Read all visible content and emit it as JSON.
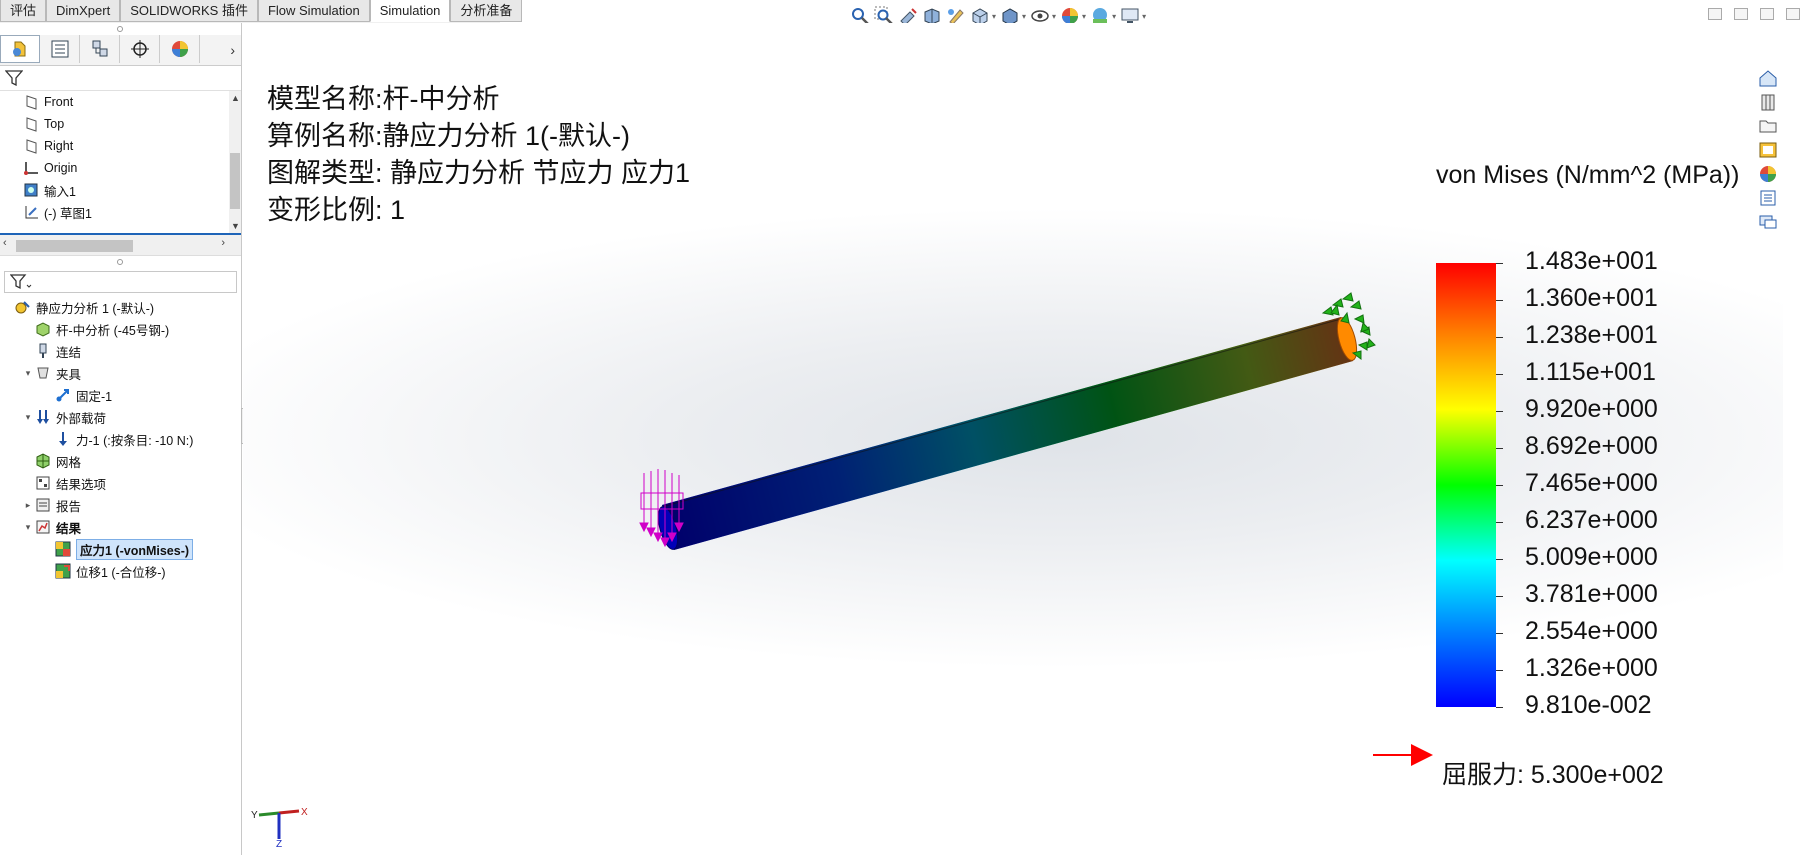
{
  "tabs": [
    "评估",
    "DimXpert",
    "SOLIDWORKS 插件",
    "Flow Simulation",
    "Simulation",
    "分析准备"
  ],
  "active_tab": "Simulation",
  "view_toolbar_icons": [
    "zoom-to-fit-icon",
    "zoom-to-area-icon",
    "previous-view-icon",
    "section-view-icon",
    "dynamic-annotation-icon",
    "view-orientation-icon",
    "display-style-icon",
    "hide-show-items-icon",
    "edit-appearance-icon",
    "apply-scene-icon",
    "view-settings-icon"
  ],
  "manager_tabs": [
    "featuremanager-icon",
    "propertymanager-icon",
    "configurationmanager-icon",
    "dimxpertmanager-icon",
    "displaymanager-icon"
  ],
  "feature_tree": [
    {
      "label": "Front",
      "icon": "plane-icon"
    },
    {
      "label": "Top",
      "icon": "plane-icon"
    },
    {
      "label": "Right",
      "icon": "plane-icon"
    },
    {
      "label": "Origin",
      "icon": "origin-icon"
    },
    {
      "label": "输入1",
      "icon": "imported-body-icon"
    },
    {
      "label": "(-) 草图1",
      "icon": "sketch-icon"
    }
  ],
  "sim_tree": [
    {
      "label": "静应力分析 1 (-默认-)",
      "icon": "study-icon",
      "toggle": "",
      "indent": 0
    },
    {
      "label": "杆-中分析 (-45号钢-)",
      "icon": "part-icon",
      "toggle": "",
      "indent": 1
    },
    {
      "label": "连结",
      "icon": "connections-icon",
      "toggle": "",
      "indent": 1
    },
    {
      "label": "夹具",
      "icon": "fixtures-icon",
      "toggle": "▾",
      "indent": 1
    },
    {
      "label": "固定-1",
      "icon": "fixed-geometry-icon",
      "toggle": "",
      "indent": 2
    },
    {
      "label": "外部载荷",
      "icon": "external-loads-icon",
      "toggle": "▾",
      "indent": 1
    },
    {
      "label": "力-1 (:按条目: -10 N:)",
      "icon": "force-icon",
      "toggle": "",
      "indent": 2
    },
    {
      "label": "网格",
      "icon": "mesh-icon",
      "toggle": "",
      "indent": 1
    },
    {
      "label": "结果选项",
      "icon": "result-options-icon",
      "toggle": "",
      "indent": 1
    },
    {
      "label": "报告",
      "icon": "report-icon",
      "toggle": "▸",
      "indent": 1
    },
    {
      "label": "结果",
      "icon": "results-icon",
      "toggle": "▾",
      "indent": 1
    },
    {
      "label": "应力1 (-vonMises-)",
      "icon": "stress-plot-icon",
      "toggle": "",
      "indent": 2
    },
    {
      "label": "位移1 (-合位移-)",
      "icon": "displacement-plot-icon",
      "toggle": "",
      "indent": 2
    }
  ],
  "selected_plot": "应力1 (-vonMises-)",
  "plot_info": {
    "model_name": "模型名称:杆-中分析",
    "study_name": "算例名称:静应力分析 1(-默认-)",
    "plot_type": "图解类型: 静应力分析 节应力 应力1",
    "deformation_scale": "变形比例: 1"
  },
  "chart_data": {
    "type": "colorbar",
    "title": "von Mises (N/mm^2 (MPa))",
    "labels": [
      "1.483e+001",
      "1.360e+001",
      "1.238e+001",
      "1.115e+001",
      "9.920e+000",
      "8.692e+000",
      "7.465e+000",
      "6.237e+000",
      "5.009e+000",
      "3.781e+000",
      "2.554e+000",
      "1.326e+000",
      "9.810e-002"
    ],
    "values": [
      14.83,
      13.6,
      12.38,
      11.15,
      9.92,
      8.692,
      7.465,
      6.237,
      5.009,
      3.781,
      2.554,
      1.326,
      0.0981
    ],
    "colors": [
      "#ff0000",
      "#ff8000",
      "#ffff00",
      "#00ff00",
      "#00ffff",
      "#0080ff",
      "#0000ff"
    ]
  },
  "yield_strength": "屈服力: 5.300e+002",
  "triad_axes": [
    "Y",
    "X",
    "Z"
  ],
  "task_pane_icons": [
    "solidworks-resources-icon",
    "design-library-icon",
    "file-explorer-icon",
    "view-palette-icon",
    "appearances-icon",
    "custom-properties-icon",
    "forum-icon"
  ]
}
